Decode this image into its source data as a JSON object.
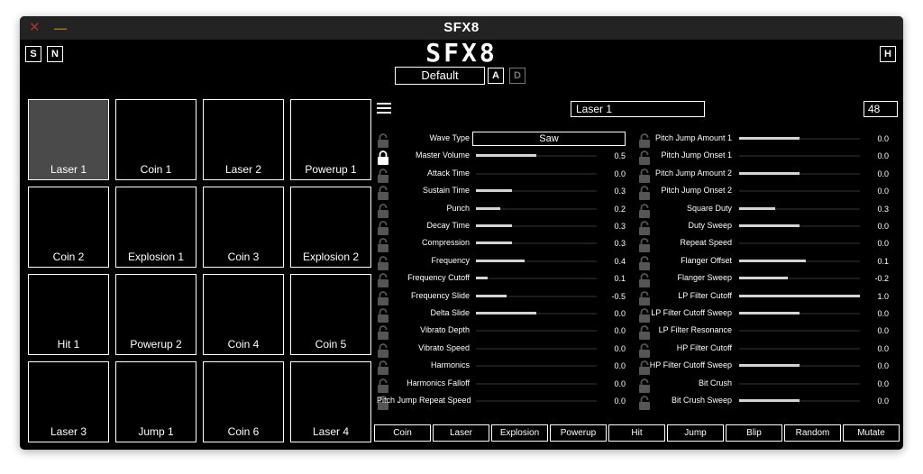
{
  "window": {
    "title": "SFX8",
    "close_glyph": "✕",
    "minimize_glyph": "—"
  },
  "header": {
    "logo": "SFX8",
    "left_buttons": [
      "S",
      "N"
    ],
    "right_button": "H",
    "preset": "Default",
    "a_button": "A",
    "d_button": "D"
  },
  "pads": [
    {
      "label": "Laser 1",
      "active": true
    },
    {
      "label": "Coin 1"
    },
    {
      "label": "Laser 2"
    },
    {
      "label": "Powerup 1"
    },
    {
      "label": "Coin 2"
    },
    {
      "label": "Explosion 1"
    },
    {
      "label": "Coin 3"
    },
    {
      "label": "Explosion 2"
    },
    {
      "label": "Hit 1"
    },
    {
      "label": "Powerup 2"
    },
    {
      "label": "Coin 4"
    },
    {
      "label": "Coin 5"
    },
    {
      "label": "Laser 3"
    },
    {
      "label": "Jump 1"
    },
    {
      "label": "Coin 6"
    },
    {
      "label": "Laser 4"
    }
  ],
  "editor": {
    "menu_icon": "hamburger-menu-icon",
    "sound_name": "Laser 1",
    "sound_number": "48"
  },
  "params_left": [
    {
      "label": "Wave Type",
      "type": "select",
      "value": "Saw",
      "locked": false
    },
    {
      "label": "Master Volume",
      "level": 0.5,
      "value": "0.5",
      "locked": true
    },
    {
      "label": "Attack Time",
      "level": 0.0,
      "value": "0.0",
      "locked": false
    },
    {
      "label": "Sustain Time",
      "level": 0.3,
      "value": "0.3",
      "locked": false
    },
    {
      "label": "Punch",
      "level": 0.2,
      "value": "0.2",
      "locked": false
    },
    {
      "label": "Decay Time",
      "level": 0.3,
      "value": "0.3",
      "locked": false
    },
    {
      "label": "Compression",
      "level": 0.3,
      "value": "0.3",
      "locked": false
    },
    {
      "label": "Frequency",
      "level": 0.4,
      "value": "0.4",
      "locked": false
    },
    {
      "label": "Frequency Cutoff",
      "level": 0.1,
      "value": "0.1",
      "locked": false
    },
    {
      "label": "Frequency Slide",
      "level": 0.25,
      "value": "-0.5",
      "locked": false
    },
    {
      "label": "Delta Slide",
      "level": 0.5,
      "value": "0.0",
      "locked": false
    },
    {
      "label": "Vibrato Depth",
      "level": 0.0,
      "value": "0.0",
      "locked": false
    },
    {
      "label": "Vibrato Speed",
      "level": 0.0,
      "value": "0.0",
      "locked": false
    },
    {
      "label": "Harmonics",
      "level": 0.0,
      "value": "0.0",
      "locked": false
    },
    {
      "label": "Harmonics Falloff",
      "level": 0.0,
      "value": "0.0",
      "locked": false
    },
    {
      "label": "Pitch Jump Repeat Speed",
      "level": 0.0,
      "value": "0.0",
      "locked": false
    }
  ],
  "params_right": [
    {
      "label": "Pitch Jump Amount 1",
      "level": 0.5,
      "value": "0.0",
      "locked": false
    },
    {
      "label": "Pitch Jump Onset 1",
      "level": 0.0,
      "value": "0.0",
      "locked": false
    },
    {
      "label": "Pitch Jump Amount 2",
      "level": 0.5,
      "value": "0.0",
      "locked": false
    },
    {
      "label": "Pitch Jump Onset 2",
      "level": 0.0,
      "value": "0.0",
      "locked": false
    },
    {
      "label": "Square Duty",
      "level": 0.3,
      "value": "0.3",
      "locked": false
    },
    {
      "label": "Duty Sweep",
      "level": 0.5,
      "value": "0.0",
      "locked": false
    },
    {
      "label": "Repeat Speed",
      "level": 0.0,
      "value": "0.0",
      "locked": false
    },
    {
      "label": "Flanger Offset",
      "level": 0.55,
      "value": "0.1",
      "locked": false
    },
    {
      "label": "Flanger Sweep",
      "level": 0.4,
      "value": "-0.2",
      "locked": false
    },
    {
      "label": "LP Filter Cutoff",
      "level": 1.0,
      "value": "1.0",
      "locked": false
    },
    {
      "label": "LP Filter Cutoff Sweep",
      "level": 0.5,
      "value": "0.0",
      "locked": false
    },
    {
      "label": "LP Filter Resonance",
      "level": 0.0,
      "value": "0.0",
      "locked": false
    },
    {
      "label": "HP Filter Cutoff",
      "level": 0.0,
      "value": "0.0",
      "locked": false
    },
    {
      "label": "HP Filter Cutoff Sweep",
      "level": 0.5,
      "value": "0.0",
      "locked": false
    },
    {
      "label": "Bit Crush",
      "level": 0.0,
      "value": "0.0",
      "locked": false
    },
    {
      "label": "Bit Crush Sweep",
      "level": 0.5,
      "value": "0.0",
      "locked": false
    }
  ],
  "generators": [
    "Coin",
    "Laser",
    "Explosion",
    "Powerup",
    "Hit",
    "Jump",
    "Blip",
    "Random",
    "Mutate"
  ],
  "colors": {
    "background": "#000000",
    "foreground": "#ffffff",
    "active_pad": "#4a4a4a",
    "slider_fill": "#d4d4d4"
  }
}
